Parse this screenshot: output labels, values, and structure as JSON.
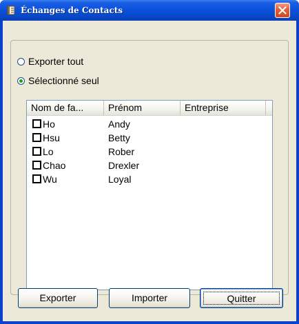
{
  "window": {
    "title": "Échanges de Contacts",
    "icon": "address-book-icon",
    "close_icon": "close-icon"
  },
  "options": [
    {
      "label": "Exporter tout",
      "checked": false
    },
    {
      "label": "Sélectionné seul",
      "checked": true
    }
  ],
  "list": {
    "columns": [
      "Nom de fa...",
      "Prénom",
      "Entreprise"
    ],
    "rows": [
      {
        "last_name": "Ho",
        "first_name": "Andy",
        "company": "",
        "checked": false
      },
      {
        "last_name": "Hsu",
        "first_name": "Betty",
        "company": "",
        "checked": false
      },
      {
        "last_name": "Lo",
        "first_name": "Rober",
        "company": "",
        "checked": false
      },
      {
        "last_name": "Chao",
        "first_name": "Drexler",
        "company": "",
        "checked": false
      },
      {
        "last_name": "Wu",
        "first_name": "Loyal",
        "company": "",
        "checked": false
      }
    ]
  },
  "buttons": {
    "export_label": "Exporter",
    "import_label": "Importer",
    "quit_label": "Quitter"
  },
  "colors": {
    "titlebar": "#0a52dc",
    "dialog_bg": "#ece9d8",
    "close_button": "#e3623c",
    "radio_dot": "#21a121"
  }
}
